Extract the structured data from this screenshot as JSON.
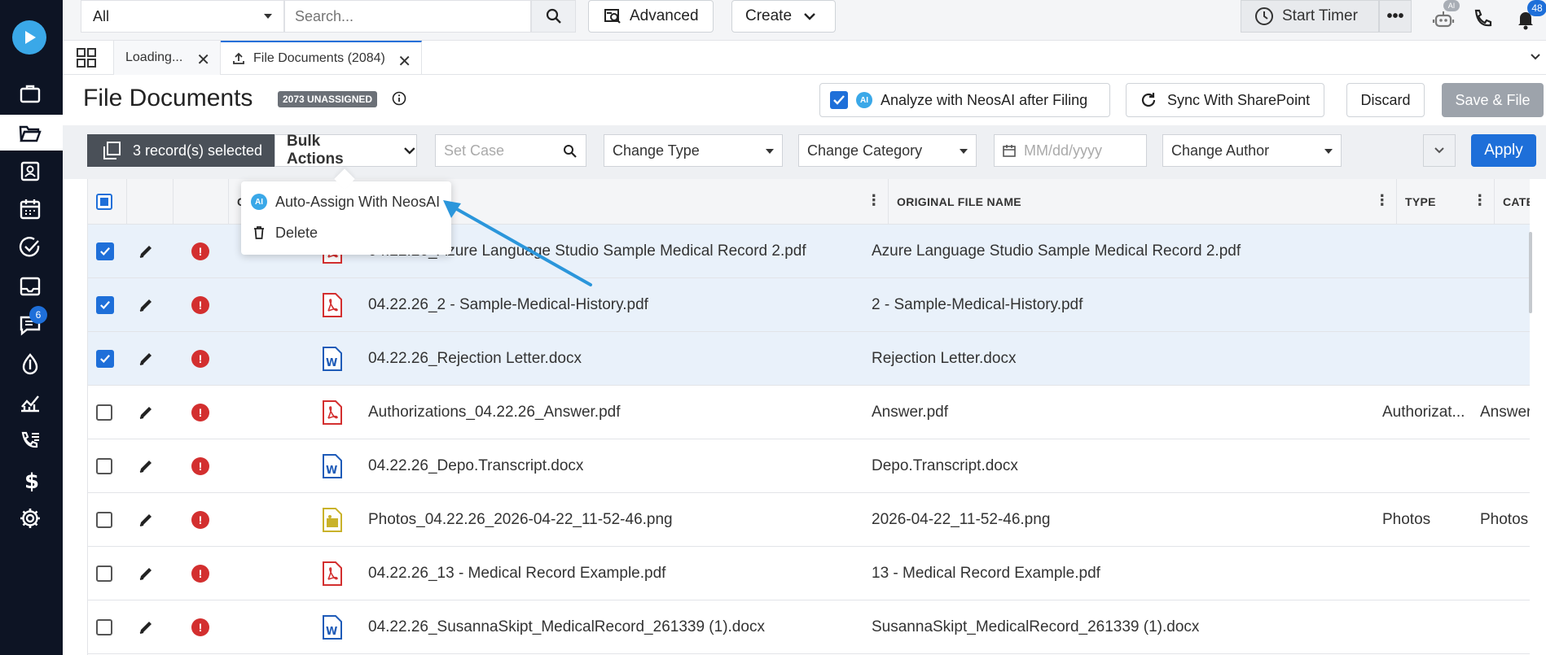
{
  "search": {
    "scope": "All",
    "placeholder": "Search..."
  },
  "topbar": {
    "advanced_label": "Advanced",
    "create_label": "Create",
    "timer_label": "Start Timer",
    "ai_badge": "AI",
    "notifications_count": "48"
  },
  "nav": {
    "messages_count": "6"
  },
  "tabs": [
    {
      "label": "Loading..."
    },
    {
      "label": "File Documents (2084)"
    }
  ],
  "header": {
    "title": "File Documents",
    "unassigned_badge": "2073 UNASSIGNED",
    "analyze_label": "Analyze with NeosAI after Filing",
    "ai_chip": "AI",
    "sync_label": "Sync With SharePoint",
    "discard_label": "Discard",
    "save_label": "Save & File"
  },
  "toolbar": {
    "selected_label": "3 record(s) selected",
    "bulk_label": "Bulk Actions",
    "set_case_placeholder": "Set Case",
    "change_type": "Change Type",
    "change_category": "Change Category",
    "date_placeholder": "MM/dd/yyyy",
    "change_author": "Change Author",
    "apply_label": "Apply"
  },
  "bulk_menu": {
    "auto_assign": "Auto-Assign With NeosAI",
    "delete": "Delete",
    "ai_chip": "AI"
  },
  "columns": {
    "col_c": "C",
    "original_file_name": "ORIGINAL FILE NAME",
    "type": "TYPE",
    "category": "CATEGO"
  },
  "rows": [
    {
      "selected": true,
      "icon": "pdf",
      "name": "04.22.26_Azure Language Studio Sample Medical Record 2.pdf",
      "name_visible": "04.22.26_Azure Language Studio Sample Medical Record 2.pdf",
      "original": "Azure Language Studio Sample Medical Record 2.pdf",
      "type": "",
      "category": ""
    },
    {
      "selected": true,
      "icon": "pdf",
      "name": "04.22.26_2 - Sample-Medical-History.pdf",
      "original": "2 - Sample-Medical-History.pdf",
      "type": "",
      "category": ""
    },
    {
      "selected": true,
      "icon": "word",
      "name": "04.22.26_Rejection Letter.docx",
      "original": "Rejection Letter.docx",
      "type": "",
      "category": ""
    },
    {
      "selected": false,
      "icon": "pdf",
      "name": "Authorizations_04.22.26_Answer.pdf",
      "original": "Answer.pdf",
      "type": "Authorizat...",
      "category": "Answer"
    },
    {
      "selected": false,
      "icon": "word",
      "name": "04.22.26_Depo.Transcript.docx",
      "original": "Depo.Transcript.docx",
      "type": "",
      "category": ""
    },
    {
      "selected": false,
      "icon": "image",
      "name": "Photos_04.22.26_2026-04-22_11-52-46.png",
      "original": "2026-04-22_11-52-46.png",
      "type": "Photos",
      "category": "Photos"
    },
    {
      "selected": false,
      "icon": "pdf",
      "name": "04.22.26_13 - Medical Record Example.pdf",
      "original": "13 - Medical Record Example.pdf",
      "type": "",
      "category": ""
    },
    {
      "selected": false,
      "icon": "word",
      "name": "04.22.26_SusannaSkipt_MedicalRecord_261339 (1).docx",
      "original": "SusannaSkipt_MedicalRecord_261339 (1).docx",
      "type": "",
      "category": ""
    }
  ],
  "colors": {
    "accent": "#1e6fd9",
    "nav_bg": "#0d1424",
    "error": "#d32f2f",
    "pdf": "#d32f2f",
    "word": "#1e5bb8",
    "image": "#c9b22a"
  }
}
